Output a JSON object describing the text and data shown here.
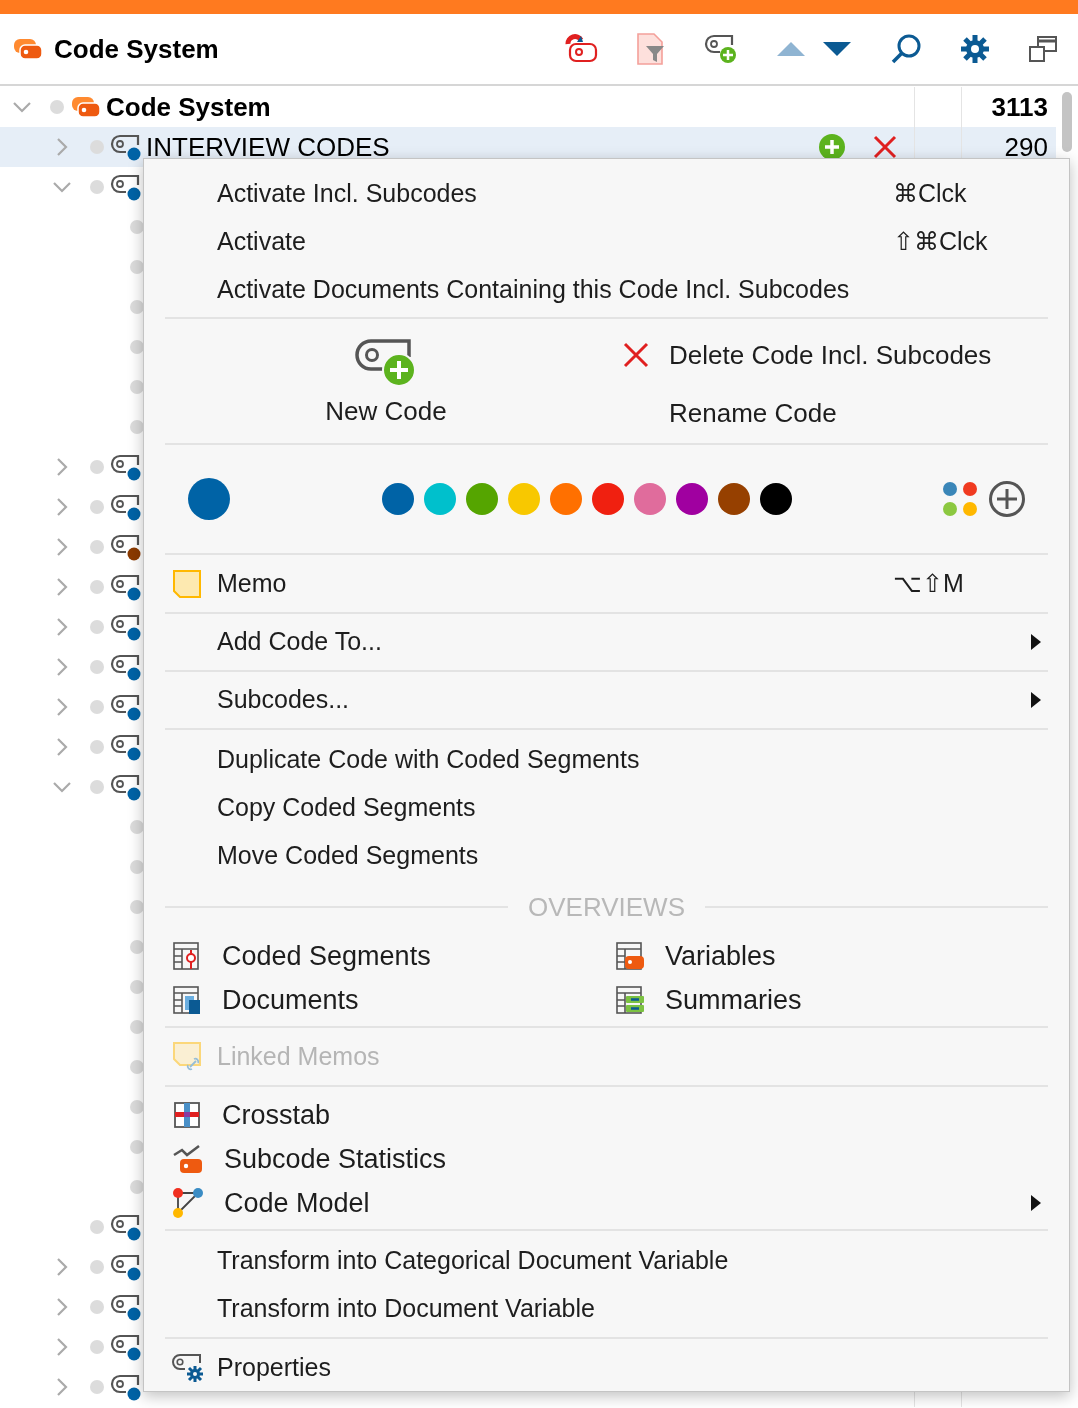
{
  "header": {
    "title": "Code System"
  },
  "tree": {
    "root": {
      "label": "Code System",
      "count": "3113",
      "expanded": true,
      "children": [
        {
          "label": "INTERVIEW CODES",
          "count": "290",
          "expanded": false,
          "selected": true,
          "color": "#0063a6"
        },
        {
          "expanded": true,
          "selected": false,
          "color": "#0063a6",
          "children": [
            {
              "leaf": true,
              "selected": false
            },
            {
              "leaf": true,
              "selected": false
            },
            {
              "leaf": true,
              "selected": false
            },
            {
              "leaf": true,
              "selected": false
            },
            {
              "leaf": true,
              "selected": false
            },
            {
              "leaf": true,
              "selected": false
            }
          ]
        },
        {
          "expanded": false,
          "selected": false,
          "color": "#0063a6"
        },
        {
          "expanded": false,
          "selected": false,
          "color": "#0063a6"
        },
        {
          "expanded": false,
          "selected": false,
          "color": "#8b3a00"
        },
        {
          "expanded": false,
          "selected": false,
          "color": "#0063a6"
        },
        {
          "expanded": false,
          "selected": false,
          "color": "#0063a6"
        },
        {
          "expanded": false,
          "selected": false,
          "color": "#0063a6"
        },
        {
          "expanded": false,
          "selected": false,
          "color": "#0063a6"
        },
        {
          "expanded": false,
          "selected": false,
          "color": "#0063a6"
        },
        {
          "expanded": true,
          "selected": false,
          "color": "#0063a6",
          "children": [
            {
              "leaf": true,
              "selected": false
            },
            {
              "leaf": true,
              "selected": false
            },
            {
              "leaf": true,
              "selected": false
            },
            {
              "leaf": true,
              "selected": false
            },
            {
              "leaf": true,
              "selected": false
            },
            {
              "leaf": true,
              "selected": false
            },
            {
              "leaf": true,
              "selected": false
            },
            {
              "leaf": true,
              "selected": false
            },
            {
              "leaf": true,
              "selected": false
            },
            {
              "leaf": true,
              "selected": false
            }
          ]
        },
        {
          "leaf": true,
          "selected": false,
          "color": "#0063a6"
        },
        {
          "expanded": false,
          "selected": false,
          "color": "#0063a6"
        },
        {
          "expanded": false,
          "selected": false,
          "color": "#0063a6"
        },
        {
          "expanded": false,
          "selected": false,
          "color": "#0063a6"
        },
        {
          "expanded": false,
          "selected": false,
          "color": "#0063a6"
        }
      ]
    }
  },
  "menu": {
    "activate_items": [
      {
        "label": "Activate Incl. Subcodes",
        "shortcut": "⌘Clck"
      },
      {
        "label": "Activate",
        "shortcut": "⇧⌘Clck"
      },
      {
        "label": "Activate Documents Containing this Code Incl. Subcodes"
      }
    ],
    "new_code": "New Code",
    "delete": "Delete Code Incl. Subcodes",
    "rename": "Rename Code",
    "current_color": {
      "color": "#0063a6"
    },
    "palette": [
      {
        "color": "#0063a6"
      },
      {
        "color": "#00c0cc"
      },
      {
        "color": "#55a500"
      },
      {
        "color": "#f8c800"
      },
      {
        "color": "#ff7000"
      },
      {
        "color": "#f02010"
      },
      {
        "color": "#e06c9c"
      },
      {
        "color": "#a000a0"
      },
      {
        "color": "#964000"
      },
      {
        "color": "#000000"
      }
    ],
    "memo": {
      "label": "Memo",
      "shortcut": "⌥⇧M"
    },
    "submenus": [
      {
        "label": "Add Code To...",
        "has_submenu": true
      },
      {
        "label": "Subcodes...",
        "has_submenu": true
      }
    ],
    "segment_items": [
      "Duplicate Code with Coded Segments",
      "Copy Coded Segments",
      "Move Coded Segments"
    ],
    "overviews_heading": "OVERVIEWS",
    "overviews": [
      {
        "label": "Coded Segments",
        "kind": "segments"
      },
      {
        "label": "Variables",
        "kind": "variables"
      },
      {
        "label": "Documents",
        "kind": "documents"
      },
      {
        "label": "Summaries",
        "kind": "summaries"
      }
    ],
    "linked_memos": {
      "label": "Linked Memos",
      "disabled": true
    },
    "analysis": [
      {
        "label": "Crosstab",
        "kind": "crosstab",
        "has_submenu": false
      },
      {
        "label": "Subcode Statistics",
        "kind": "statistics",
        "has_submenu": false
      },
      {
        "label": "Code Model",
        "kind": "model",
        "has_submenu": true
      }
    ],
    "transform_items": [
      "Transform into Categorical Document Variable",
      "Transform into Document Variable"
    ],
    "properties": "Properties"
  }
}
